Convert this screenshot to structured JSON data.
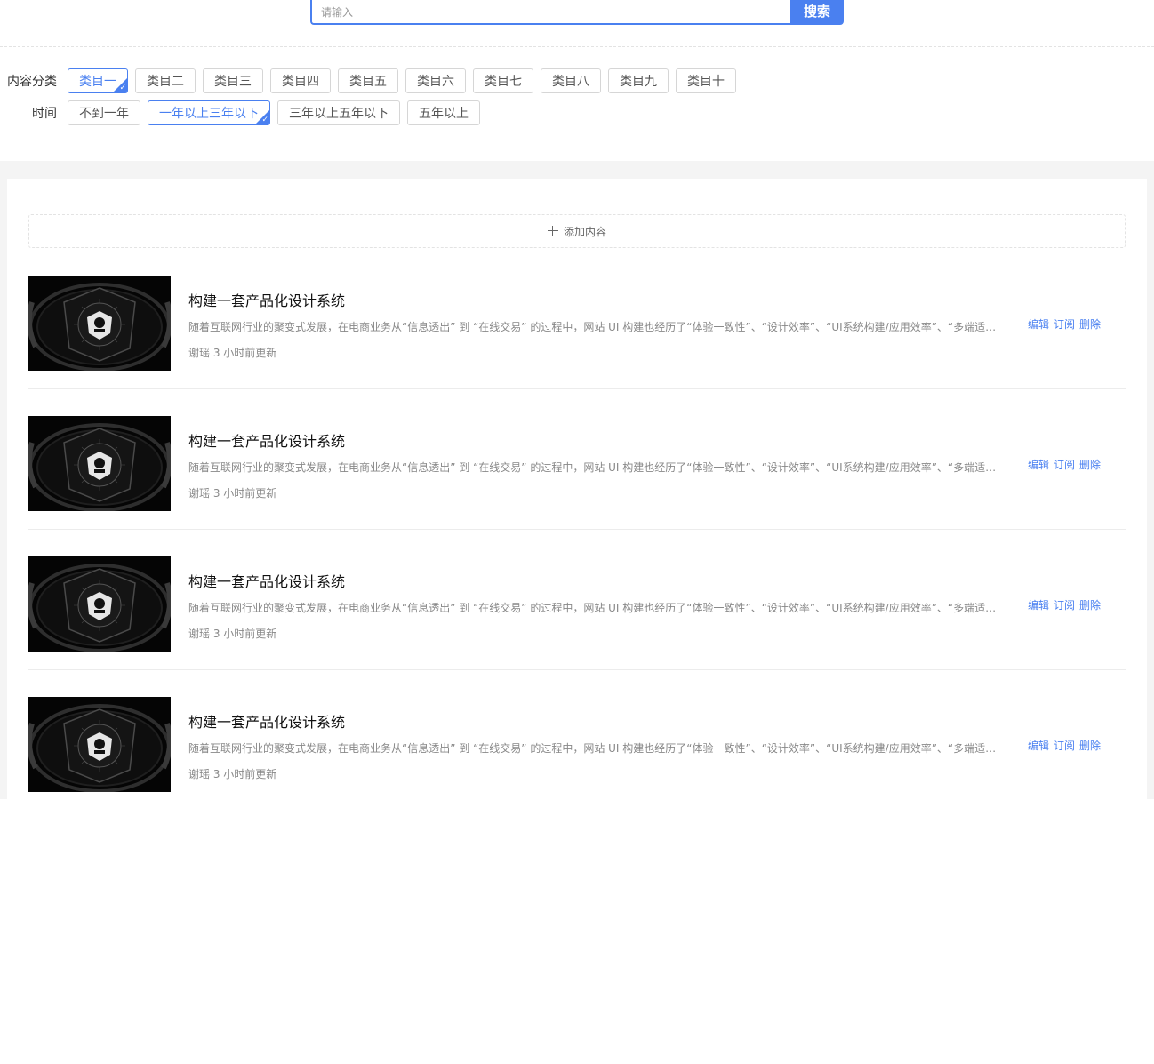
{
  "search": {
    "placeholder": "请输入",
    "button_label": "搜索"
  },
  "filters": {
    "category": {
      "label": "内容分类",
      "options": [
        "类目一",
        "类目二",
        "类目三",
        "类目四",
        "类目五",
        "类目六",
        "类目七",
        "类目八",
        "类目九",
        "类目十"
      ],
      "selected": "类目一"
    },
    "time": {
      "label": "时间",
      "options": [
        "不到一年",
        "一年以上三年以下",
        "三年以上五年以下",
        "五年以上"
      ],
      "selected": "一年以上三年以下"
    }
  },
  "add_button": {
    "label": "添加内容",
    "icon": "plus-icon"
  },
  "items": [
    {
      "title": "构建一套产品化设计系统",
      "description": "随着互联网行业的聚变式发展，在电商业务从“信息透出” 到 “在线交易” 的过程中，网站 UI 构建也经历了“体验一致性”、“设计效率”、“UI系统构建/应用效率”、“多端适配” 等多个阶段的发展。",
      "meta": "谢瑶 3 小时前更新",
      "actions": {
        "edit": "编辑",
        "subscribe": "订阅",
        "delete": "删除"
      }
    },
    {
      "title": "构建一套产品化设计系统",
      "description": "随着互联网行业的聚变式发展，在电商业务从“信息透出” 到 “在线交易” 的过程中，网站 UI 构建也经历了“体验一致性”、“设计效率”、“UI系统构建/应用效率”、“多端适配” 等多个阶段的发展。",
      "meta": "谢瑶 3 小时前更新",
      "actions": {
        "edit": "编辑",
        "subscribe": "订阅",
        "delete": "删除"
      }
    },
    {
      "title": "构建一套产品化设计系统",
      "description": "随着互联网行业的聚变式发展，在电商业务从“信息透出” 到 “在线交易” 的过程中，网站 UI 构建也经历了“体验一致性”、“设计效率”、“UI系统构建/应用效率”、“多端适配” 等多个阶段的发展。",
      "meta": "谢瑶 3 小时前更新",
      "actions": {
        "edit": "编辑",
        "subscribe": "订阅",
        "delete": "删除"
      }
    },
    {
      "title": "构建一套产品化设计系统",
      "description": "随着互联网行业的聚变式发展，在电商业务从“信息透出” 到 “在线交易” 的过程中，网站 UI 构建也经历了“体验一致性”、“设计效率”、“UI系统构建/应用效率”、“多端适配” 等多个阶段的发展。",
      "meta": "谢瑶 3 小时前更新",
      "actions": {
        "edit": "编辑",
        "subscribe": "订阅",
        "delete": "删除"
      }
    }
  ],
  "colors": {
    "accent": "#4a80f0",
    "background_gray": "#f4f4f4",
    "thumbnail_bg": "#050505"
  }
}
